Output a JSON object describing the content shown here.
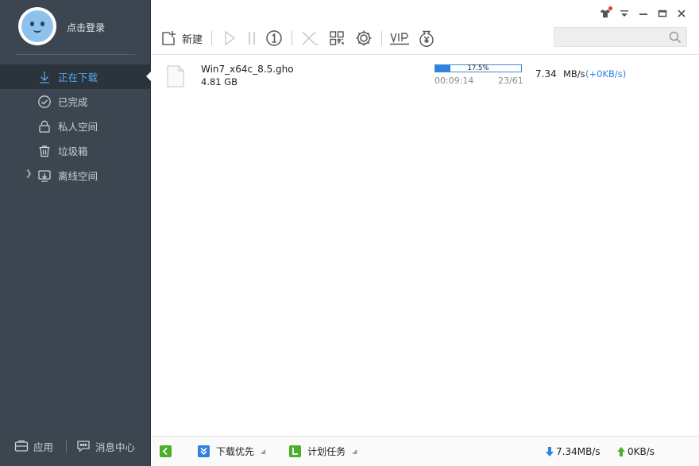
{
  "user": {
    "login_text": "点击登录"
  },
  "nav": {
    "items": [
      {
        "label": "正在下载",
        "icon": "download-arrow-icon",
        "active": true
      },
      {
        "label": "已完成",
        "icon": "check-circle-icon",
        "active": false
      },
      {
        "label": "私人空间",
        "icon": "lock-icon",
        "active": false
      },
      {
        "label": "垃圾箱",
        "icon": "trash-icon",
        "active": false
      },
      {
        "label": "离线空间",
        "icon": "offline-download-icon",
        "active": false,
        "expandable": true
      }
    ]
  },
  "sidebar_bottom": {
    "apps_label": "应用",
    "messages_label": "消息中心"
  },
  "toolbar": {
    "new_label": "新建",
    "icons": [
      "play-icon",
      "pause-icon",
      "one-at-a-time-icon",
      "delete-icon",
      "grid-icon",
      "settings-icon",
      "vip-icon",
      "money-bag-icon"
    ]
  },
  "search": {
    "placeholder": ""
  },
  "download": {
    "file_name": "Win7_x64c_8.5.gho",
    "file_size": "4.81 GB",
    "progress": 0.175,
    "progress_text": "17.5%",
    "elapsed": "00:09:14",
    "pieces": "23/61",
    "speed": "7.34",
    "speed_unit": "MB/s",
    "speed_extra": "(+0KB/s)"
  },
  "statusbar": {
    "priority_label": "下载优先",
    "plan_label": "计划任务",
    "down_speed": "7.34MB/s",
    "up_speed": "0KB/s"
  },
  "colors": {
    "sidebar_bg": "#3c4650",
    "accent_blue": "#2f82de",
    "active_nav_text": "#56a9f0",
    "status_green": "#4caf2a"
  }
}
